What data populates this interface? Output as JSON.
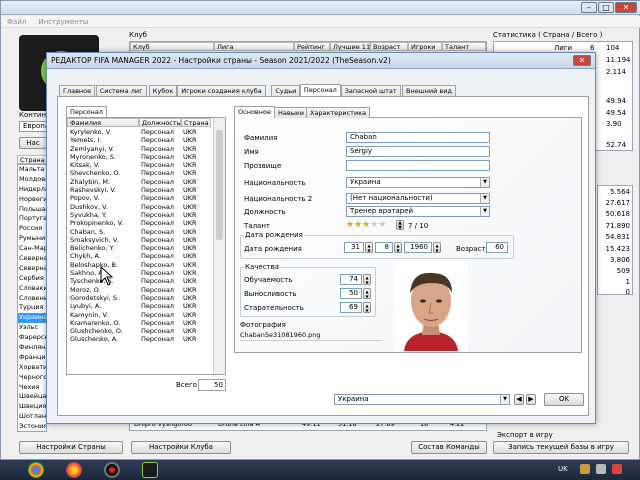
{
  "main": {
    "menu": [
      "Файл",
      "Инструменты"
    ],
    "club_panel": {
      "title": "Клуб",
      "headers": [
        "Клуб",
        "Лига",
        "Рейтинг",
        "Лучшие 11",
        "Возраст",
        "Игроки",
        "Талант"
      ],
      "bottom_row": [
        "Dnipro Vyshgorod",
        "Druha Liha A",
        "49.11",
        "51.18",
        "27.89",
        "18",
        "4.22"
      ]
    },
    "stats_panel": {
      "title": "Статистика ( Страна / Всего )",
      "rows": [
        {
          "label": "Лиги",
          "v1": "6",
          "v2": "104"
        },
        {
          "label": "",
          "v1": "",
          "v2": "11.194"
        },
        {
          "label": "",
          "v1": "",
          "v2": "2.114"
        },
        {
          "label": "",
          "v1": "",
          "v2": "49.94"
        },
        {
          "label": "",
          "v1": "",
          "v2": "49.54"
        },
        {
          "label": "",
          "v1": "",
          "v2": "3.90"
        },
        {
          "label": "",
          "v1": "",
          "v2": "52.74"
        }
      ],
      "right_values": [
        "5.564",
        "27.617",
        "50.618",
        "71.890",
        "54.831",
        "15.423",
        "3.806",
        "509",
        "1",
        "0"
      ]
    },
    "left_list": {
      "label_top": "Контин",
      "value_top": "Европа",
      "btn": "Нас",
      "header": "Страна",
      "items": [
        "Мальта",
        "Молдова",
        "Нидерланды",
        "Норвегия",
        "Польша",
        "Португалия",
        "Россия",
        "Румыния",
        "Сан-Марино",
        "Северная",
        "Северная",
        "Сербия",
        "Словакия",
        "Словения",
        "Турция",
        "Украина",
        "Уэльс",
        "Фарерские",
        "Финляндия",
        "Франция",
        "Хорватия",
        "Черногория",
        "Чехия",
        "Швейцария",
        "Швеция",
        "Шотландия",
        "Эстония"
      ],
      "selected": "Украина"
    },
    "bottom_buttons": {
      "country_settings": "Настройки Страны",
      "club_settings": "Настройки Клуба",
      "team_composition": "Состав Команды"
    },
    "export": {
      "title": "Экспорт в игру",
      "button": "Запись текущей базы в игру"
    }
  },
  "dialog": {
    "title": "РЕДАКТОР FIFA MANAGER 2022 - Настройки страны - Season 2021/2022 (TheSeason.v2)",
    "tabs": [
      "Главное",
      "Система лиг",
      "Кубок",
      "Игроки создания клуба",
      "Судьи",
      "Персонал",
      "Запасной штат",
      "Внешний вид"
    ],
    "active_tab": "Персонал",
    "staff_box_label": "Персонал",
    "list_headers": [
      "Фамилия",
      "Должность",
      "Страна"
    ],
    "staff": [
      {
        "name": "Kyrylenko, V.",
        "role": "Персонал",
        "country": "UKR"
      },
      {
        "name": "Yemets, I.",
        "role": "Персонал",
        "country": "UKR"
      },
      {
        "name": "Zemlyanyi, V.",
        "role": "Персонал",
        "country": "UKR"
      },
      {
        "name": "Myronenko, S.",
        "role": "Персонал",
        "country": "UKR"
      },
      {
        "name": "Kitsak, V.",
        "role": "Персонал",
        "country": "UKR"
      },
      {
        "name": "Shevchenko, O.",
        "role": "Персонал",
        "country": "UKR"
      },
      {
        "name": "Zhalybin, M.",
        "role": "Персонал",
        "country": "UKR"
      },
      {
        "name": "Rashevskyi, V.",
        "role": "Персонал",
        "country": "UKR"
      },
      {
        "name": "Popov, V.",
        "role": "Персонал",
        "country": "UKR"
      },
      {
        "name": "Dushkov, V.",
        "role": "Персонал",
        "country": "UKR"
      },
      {
        "name": "Syvukha, Y.",
        "role": "Персонал",
        "country": "UKR"
      },
      {
        "name": "Prokopinenko, V.",
        "role": "Персонал",
        "country": "UKR"
      },
      {
        "name": "Chaban, S.",
        "role": "Персонал",
        "country": "UKR"
      },
      {
        "name": "Smaksyvich, V.",
        "role": "Персонал",
        "country": "UKR"
      },
      {
        "name": "Belichenko, Y.",
        "role": "Персонал",
        "country": "UKR"
      },
      {
        "name": "Chykh, A.",
        "role": "Персонал",
        "country": "UKR"
      },
      {
        "name": "Beloshapko, B.",
        "role": "Персонал",
        "country": "UKR"
      },
      {
        "name": "Sakhno, A.",
        "role": "Персонал",
        "country": "UKR"
      },
      {
        "name": "Tyschenko, S.",
        "role": "Персонал",
        "country": "UKR"
      },
      {
        "name": "Moroz, O.",
        "role": "Персонал",
        "country": "UKR"
      },
      {
        "name": "Gorodetskyi, S.",
        "role": "Персонал",
        "country": "UKR"
      },
      {
        "name": "Lyubyi, A.",
        "role": "Персонал",
        "country": "UKR"
      },
      {
        "name": "Kamynin, V.",
        "role": "Персонал",
        "country": "UKR"
      },
      {
        "name": "Kramarenko, O.",
        "role": "Персонал",
        "country": "UKR"
      },
      {
        "name": "Glushchenko, O.",
        "role": "Персонал",
        "country": "UKR"
      },
      {
        "name": "Gluschenko, A.",
        "role": "Персонал",
        "country": "UKR"
      }
    ],
    "total_label": "Всего",
    "total_value": "50",
    "detail_tabs": [
      "Основное",
      "Навыки",
      "Характеристика"
    ],
    "form": {
      "surname_label": "Фамилия",
      "surname": "Chaban",
      "name_label": "Имя",
      "name": "Sergiy",
      "nickname_label": "Прозвище",
      "nickname": "",
      "nationality_label": "Национальность",
      "nationality": "Украина",
      "nationality2_label": "Национальность 2",
      "nationality2": "(Нет национальности)",
      "position_label": "Должность",
      "position": "Тренер вратарей",
      "talent_label": "Талант",
      "talent_stars": 3,
      "talent_max": 5,
      "talent_value": "7 / 10"
    },
    "birth": {
      "group": "Дата рождения",
      "label": "Дата рождения",
      "day": "31",
      "month": "8",
      "year": "1960",
      "age_label": "Возраст",
      "age": "60"
    },
    "qualities": {
      "group": "Качества",
      "rows": [
        {
          "label": "Обучаемость",
          "value": "74"
        },
        {
          "label": "Выносливость",
          "value": "50"
        },
        {
          "label": "Старательность",
          "value": "69"
        }
      ]
    },
    "photo": {
      "label": "Фотография",
      "filename": "Chaban5e31081960.png"
    },
    "bottom_combo": "Украина",
    "ok_button": "OK"
  },
  "taskbar": {
    "lang": "UK"
  }
}
